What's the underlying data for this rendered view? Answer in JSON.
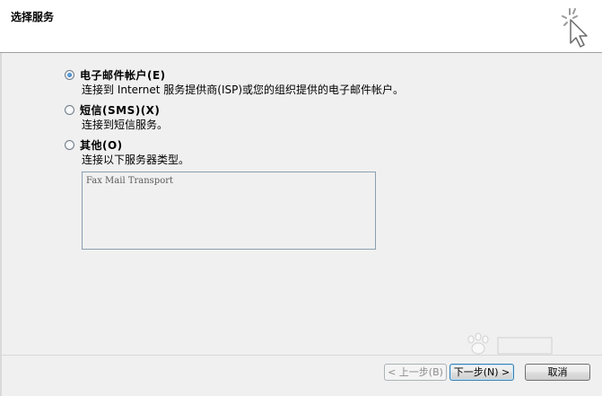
{
  "header": {
    "title": "选择服务"
  },
  "options": [
    {
      "label": "电子邮件帐户(E)",
      "description": "连接到 Internet 服务提供商(ISP)或您的组织提供的电子邮件帐户。",
      "checked": true
    },
    {
      "label": "短信(SMS)(X)",
      "description": "连接到短信服务。",
      "checked": false
    },
    {
      "label": "其他(O)",
      "description": "连接以下服务器类型。",
      "checked": false
    }
  ],
  "service_list": {
    "items": [
      "Fax Mail Transport"
    ]
  },
  "buttons": {
    "back": "< 上一步(B)",
    "next": "下一步(N) >",
    "cancel": "取消"
  },
  "colors": {
    "header_bg": "#ffffff",
    "dialog_bg": "#f0f0f0",
    "radio_dot": "#1e5ea8"
  },
  "icons": {
    "header": "cursor-sparkle-icon",
    "watermark": "baidu-paw-icon"
  }
}
